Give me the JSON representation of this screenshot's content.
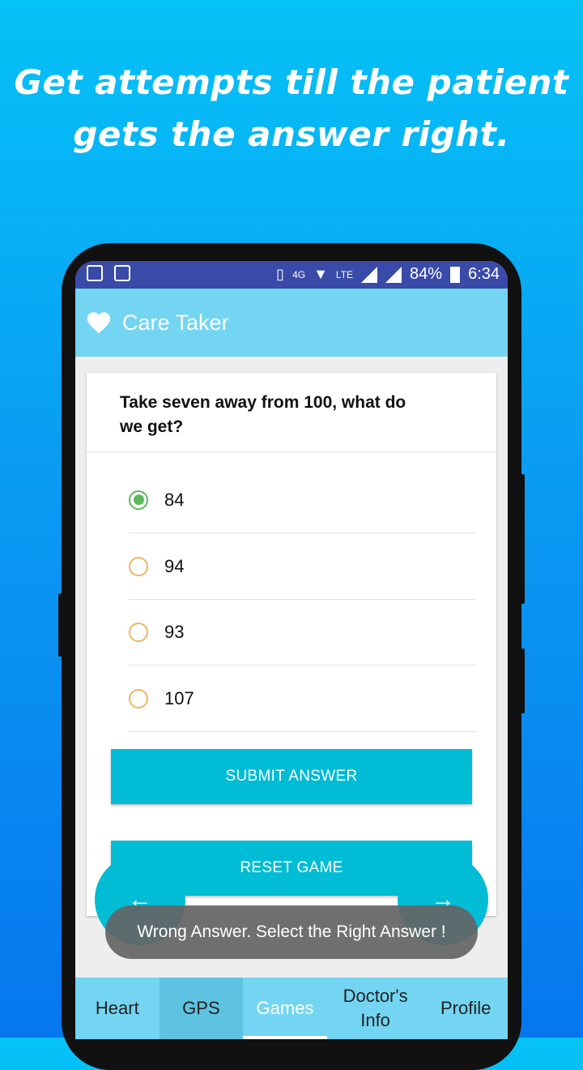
{
  "headline": {
    "line1": "Get attempts till the patient",
    "line2": "gets the answer right."
  },
  "status_bar": {
    "network": "4G",
    "lte": "LTE",
    "battery": "84%",
    "time": "6:34"
  },
  "app_bar": {
    "title": "Care Taker",
    "icon": "heart-icon"
  },
  "quiz": {
    "question": "Take seven away from 100, what do  we get?",
    "options": [
      {
        "label": "84",
        "selected": true
      },
      {
        "label": "94",
        "selected": false
      },
      {
        "label": "93",
        "selected": false
      },
      {
        "label": "107",
        "selected": false
      }
    ],
    "submit_label": "SUBMIT ANSWER",
    "reset_label": "RESET GAME"
  },
  "fabs": {
    "prev_icon": "arrow-left-icon",
    "next_icon": "arrow-right-icon"
  },
  "toast": {
    "message": "Wrong Answer. Select the Right Answer !"
  },
  "bottom_nav": {
    "items": [
      {
        "label": "Heart"
      },
      {
        "label": "GPS"
      },
      {
        "label": "Games",
        "active": true
      },
      {
        "label": "Doctor's Info"
      },
      {
        "label": "Profile"
      }
    ]
  },
  "colors": {
    "appbar": "#73d5f2",
    "status_bar": "#3a4aa8",
    "accent": "#00bcd4",
    "radio_selected": "#5cb85c",
    "radio_unselected": "#efb563"
  }
}
